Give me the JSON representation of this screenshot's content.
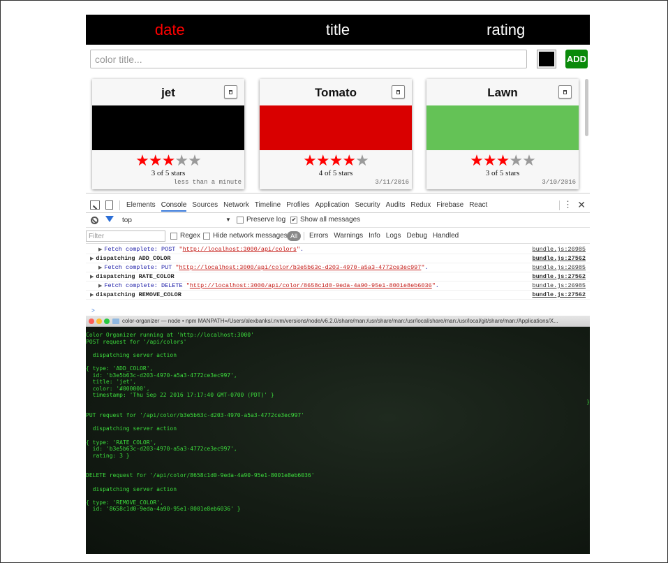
{
  "sort": {
    "options": [
      "date",
      "title",
      "rating"
    ],
    "active": "date"
  },
  "add_form": {
    "placeholder": "color title...",
    "current_color": "#000000",
    "add_label": "ADD"
  },
  "colors": [
    {
      "title": "jet",
      "color": "#000000",
      "rating": 3,
      "rating_label": "3 of 5 stars",
      "timestamp": "less than a minute"
    },
    {
      "title": "Tomato",
      "color": "#d90000",
      "rating": 4,
      "rating_label": "4 of 5 stars",
      "timestamp": "3/11/2016"
    },
    {
      "title": "Lawn",
      "color": "#64c256",
      "rating": 3,
      "rating_label": "3 of 5 stars",
      "timestamp": "3/10/2016"
    }
  ],
  "devtools": {
    "tabs": [
      "Elements",
      "Console",
      "Sources",
      "Network",
      "Timeline",
      "Profiles",
      "Application",
      "Security",
      "Audits",
      "Redux",
      "Firebase",
      "React"
    ],
    "active_tab": "Console",
    "menu_icon": "⋮",
    "close_icon": "✕",
    "context": "top",
    "context_arrow": "▼",
    "preserve_log_label": "Preserve log",
    "preserve_log_checked": false,
    "show_all_messages_label": "Show all messages",
    "show_all_messages_checked": true,
    "filter_placeholder": "Filter",
    "regex_label": "Regex",
    "hide_network_label": "Hide network messages",
    "all_label": "All",
    "levels": [
      "Errors",
      "Warnings",
      "Info",
      "Logs",
      "Debug",
      "Handled"
    ],
    "log": [
      {
        "kind": "fetch",
        "prefix": "Fetch complete: POST ",
        "url": "http://localhost:3000/api/colors",
        "suffix": ".",
        "source": "bundle.js:26985"
      },
      {
        "kind": "action",
        "text": "dispatching ADD_COLOR",
        "source": "bundle.js:27562"
      },
      {
        "kind": "fetch",
        "prefix": "Fetch complete: PUT ",
        "url": "http://localhost:3000/api/color/b3e5b63c-d203-4970-a5a3-4772ce3ec997",
        "suffix": ".",
        "source": "bundle.js:26985"
      },
      {
        "kind": "action",
        "text": "dispatching RATE_COLOR",
        "source": "bundle.js:27562"
      },
      {
        "kind": "fetch",
        "prefix": "Fetch complete: DELETE ",
        "url": "http://localhost:3000/api/color/8658c1d0-9eda-4a90-95e1-8001e8eb6036",
        "suffix": ".",
        "source": "bundle.js:26985"
      },
      {
        "kind": "action",
        "text": "dispatching REMOVE_COLOR",
        "source": "bundle.js:27562"
      }
    ],
    "prompt": ">"
  },
  "terminal": {
    "title": "color-organizer — node • npm MANPATH=/Users/alexbanks/.nvm/versions/node/v6.2.0/share/man:/usr/share/man:/usr/local/share/man:/usr/local/git/share/man:/Applications/X...",
    "right_edge": "}",
    "lines": [
      "Color Organizer running at 'http://localhost:3000'",
      "POST request for '/api/colors'",
      "",
      "  dispatching server action",
      "",
      "{ type: 'ADD_COLOR',",
      "  id: 'b3e5b63c-d203-4970-a5a3-4772ce3ec997',",
      "  title: 'jet',",
      "  color: '#000000',",
      "  timestamp: 'Thu Sep 22 2016 17:17:40 GMT-0700 (PDT)' }",
      "",
      "",
      "PUT request for '/api/color/b3e5b63c-d203-4970-a5a3-4772ce3ec997'",
      "",
      "  dispatching server action",
      "",
      "{ type: 'RATE_COLOR',",
      "  id: 'b3e5b63c-d203-4970-a5a3-4772ce3ec997',",
      "  rating: 3 }",
      "",
      "",
      "DELETE request for '/api/color/8658c1d0-9eda-4a90-95e1-8001e8eb6036'",
      "",
      "  dispatching server action",
      "",
      "{ type: 'REMOVE_COLOR',",
      "  id: '8658c1d0-9eda-4a90-95e1-8001e8eb6036' }"
    ]
  },
  "theme": {
    "sort_active": "#ff0000",
    "add_button": "#0a8a0a",
    "star_on": "#ff0000",
    "star_off": "#9a9a9a",
    "terminal_text": "#3ddc3d"
  }
}
